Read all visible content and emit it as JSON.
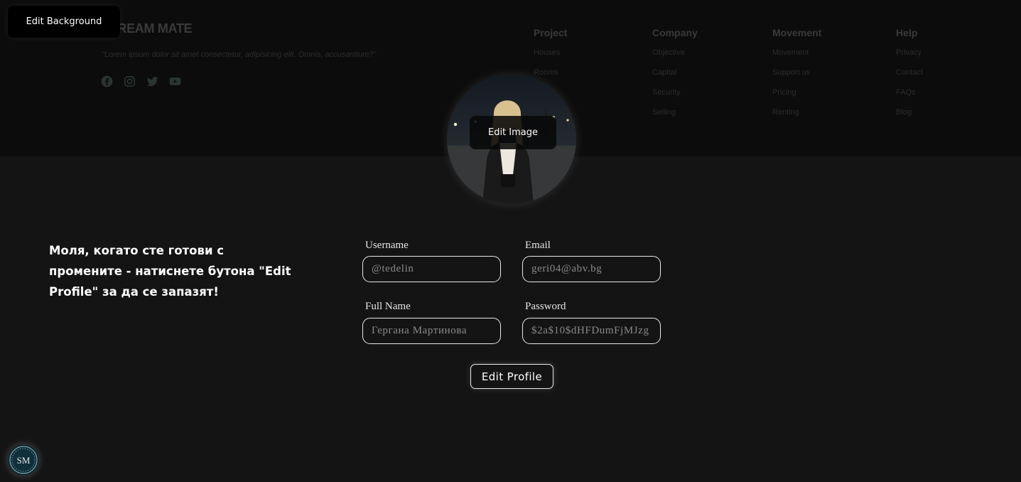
{
  "banner": {
    "brand": "STREAM MATE",
    "description": "\"Lorem ipsum dolor sit amet consectetur, adipisicing elit. Omnis, accusantium?\"",
    "socials": [
      {
        "icon": "facebook-icon"
      },
      {
        "icon": "instagram-icon"
      },
      {
        "icon": "twitter-icon"
      },
      {
        "icon": "youtube-icon"
      }
    ],
    "columns": [
      {
        "heading": "Project",
        "links": [
          "Houses",
          "Rooms"
        ]
      },
      {
        "heading": "Company",
        "links": [
          "Objective",
          "Capital",
          "Security",
          "Selling"
        ]
      },
      {
        "heading": "Movement",
        "links": [
          "Movement",
          "Support us",
          "Pricing",
          "Renting"
        ]
      },
      {
        "heading": "Help",
        "links": [
          "Privacy",
          "Contact",
          "FAQs",
          "Blog"
        ]
      }
    ]
  },
  "buttons": {
    "edit_background": "Edit Background",
    "edit_image": "Edit Image",
    "edit_profile": "Edit Profile"
  },
  "notice": "Моля, когато сте готови с промените - натиснете бутона \"Edit Profile\" за да се запазят!",
  "form": {
    "username": {
      "label": "Username",
      "value": "@tedelin"
    },
    "email": {
      "label": "Email",
      "value": "geri04@abv.bg"
    },
    "full_name": {
      "label": "Full Name",
      "value": "Гергана Мартинова"
    },
    "password": {
      "label": "Password",
      "value": "$2a$10$dHFDumFjMJzg"
    }
  },
  "logo": {
    "text": "SM"
  },
  "colors": {
    "background": "#141414",
    "banner": "#0c0c0c",
    "border": "#e9e9e9"
  }
}
